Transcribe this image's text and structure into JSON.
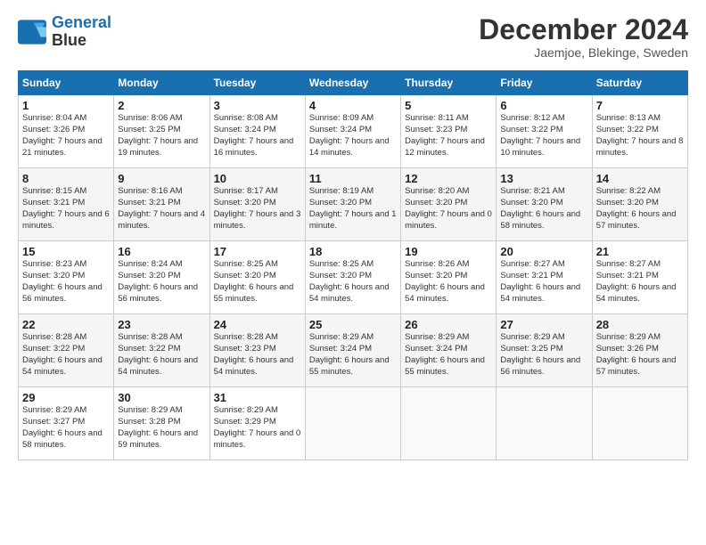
{
  "logo": {
    "line1": "General",
    "line2": "Blue"
  },
  "title": "December 2024",
  "subtitle": "Jaemjoe, Blekinge, Sweden",
  "days_header": [
    "Sunday",
    "Monday",
    "Tuesday",
    "Wednesday",
    "Thursday",
    "Friday",
    "Saturday"
  ],
  "weeks": [
    [
      {
        "day": "1",
        "sunrise": "Sunrise: 8:04 AM",
        "sunset": "Sunset: 3:26 PM",
        "daylight": "Daylight: 7 hours and 21 minutes."
      },
      {
        "day": "2",
        "sunrise": "Sunrise: 8:06 AM",
        "sunset": "Sunset: 3:25 PM",
        "daylight": "Daylight: 7 hours and 19 minutes."
      },
      {
        "day": "3",
        "sunrise": "Sunrise: 8:08 AM",
        "sunset": "Sunset: 3:24 PM",
        "daylight": "Daylight: 7 hours and 16 minutes."
      },
      {
        "day": "4",
        "sunrise": "Sunrise: 8:09 AM",
        "sunset": "Sunset: 3:24 PM",
        "daylight": "Daylight: 7 hours and 14 minutes."
      },
      {
        "day": "5",
        "sunrise": "Sunrise: 8:11 AM",
        "sunset": "Sunset: 3:23 PM",
        "daylight": "Daylight: 7 hours and 12 minutes."
      },
      {
        "day": "6",
        "sunrise": "Sunrise: 8:12 AM",
        "sunset": "Sunset: 3:22 PM",
        "daylight": "Daylight: 7 hours and 10 minutes."
      },
      {
        "day": "7",
        "sunrise": "Sunrise: 8:13 AM",
        "sunset": "Sunset: 3:22 PM",
        "daylight": "Daylight: 7 hours and 8 minutes."
      }
    ],
    [
      {
        "day": "8",
        "sunrise": "Sunrise: 8:15 AM",
        "sunset": "Sunset: 3:21 PM",
        "daylight": "Daylight: 7 hours and 6 minutes."
      },
      {
        "day": "9",
        "sunrise": "Sunrise: 8:16 AM",
        "sunset": "Sunset: 3:21 PM",
        "daylight": "Daylight: 7 hours and 4 minutes."
      },
      {
        "day": "10",
        "sunrise": "Sunrise: 8:17 AM",
        "sunset": "Sunset: 3:20 PM",
        "daylight": "Daylight: 7 hours and 3 minutes."
      },
      {
        "day": "11",
        "sunrise": "Sunrise: 8:19 AM",
        "sunset": "Sunset: 3:20 PM",
        "daylight": "Daylight: 7 hours and 1 minute."
      },
      {
        "day": "12",
        "sunrise": "Sunrise: 8:20 AM",
        "sunset": "Sunset: 3:20 PM",
        "daylight": "Daylight: 7 hours and 0 minutes."
      },
      {
        "day": "13",
        "sunrise": "Sunrise: 8:21 AM",
        "sunset": "Sunset: 3:20 PM",
        "daylight": "Daylight: 6 hours and 58 minutes."
      },
      {
        "day": "14",
        "sunrise": "Sunrise: 8:22 AM",
        "sunset": "Sunset: 3:20 PM",
        "daylight": "Daylight: 6 hours and 57 minutes."
      }
    ],
    [
      {
        "day": "15",
        "sunrise": "Sunrise: 8:23 AM",
        "sunset": "Sunset: 3:20 PM",
        "daylight": "Daylight: 6 hours and 56 minutes."
      },
      {
        "day": "16",
        "sunrise": "Sunrise: 8:24 AM",
        "sunset": "Sunset: 3:20 PM",
        "daylight": "Daylight: 6 hours and 56 minutes."
      },
      {
        "day": "17",
        "sunrise": "Sunrise: 8:25 AM",
        "sunset": "Sunset: 3:20 PM",
        "daylight": "Daylight: 6 hours and 55 minutes."
      },
      {
        "day": "18",
        "sunrise": "Sunrise: 8:25 AM",
        "sunset": "Sunset: 3:20 PM",
        "daylight": "Daylight: 6 hours and 54 minutes."
      },
      {
        "day": "19",
        "sunrise": "Sunrise: 8:26 AM",
        "sunset": "Sunset: 3:20 PM",
        "daylight": "Daylight: 6 hours and 54 minutes."
      },
      {
        "day": "20",
        "sunrise": "Sunrise: 8:27 AM",
        "sunset": "Sunset: 3:21 PM",
        "daylight": "Daylight: 6 hours and 54 minutes."
      },
      {
        "day": "21",
        "sunrise": "Sunrise: 8:27 AM",
        "sunset": "Sunset: 3:21 PM",
        "daylight": "Daylight: 6 hours and 54 minutes."
      }
    ],
    [
      {
        "day": "22",
        "sunrise": "Sunrise: 8:28 AM",
        "sunset": "Sunset: 3:22 PM",
        "daylight": "Daylight: 6 hours and 54 minutes."
      },
      {
        "day": "23",
        "sunrise": "Sunrise: 8:28 AM",
        "sunset": "Sunset: 3:22 PM",
        "daylight": "Daylight: 6 hours and 54 minutes."
      },
      {
        "day": "24",
        "sunrise": "Sunrise: 8:28 AM",
        "sunset": "Sunset: 3:23 PM",
        "daylight": "Daylight: 6 hours and 54 minutes."
      },
      {
        "day": "25",
        "sunrise": "Sunrise: 8:29 AM",
        "sunset": "Sunset: 3:24 PM",
        "daylight": "Daylight: 6 hours and 55 minutes."
      },
      {
        "day": "26",
        "sunrise": "Sunrise: 8:29 AM",
        "sunset": "Sunset: 3:24 PM",
        "daylight": "Daylight: 6 hours and 55 minutes."
      },
      {
        "day": "27",
        "sunrise": "Sunrise: 8:29 AM",
        "sunset": "Sunset: 3:25 PM",
        "daylight": "Daylight: 6 hours and 56 minutes."
      },
      {
        "day": "28",
        "sunrise": "Sunrise: 8:29 AM",
        "sunset": "Sunset: 3:26 PM",
        "daylight": "Daylight: 6 hours and 57 minutes."
      }
    ],
    [
      {
        "day": "29",
        "sunrise": "Sunrise: 8:29 AM",
        "sunset": "Sunset: 3:27 PM",
        "daylight": "Daylight: 6 hours and 58 minutes."
      },
      {
        "day": "30",
        "sunrise": "Sunrise: 8:29 AM",
        "sunset": "Sunset: 3:28 PM",
        "daylight": "Daylight: 6 hours and 59 minutes."
      },
      {
        "day": "31",
        "sunrise": "Sunrise: 8:29 AM",
        "sunset": "Sunset: 3:29 PM",
        "daylight": "Daylight: 7 hours and 0 minutes."
      },
      null,
      null,
      null,
      null
    ]
  ]
}
